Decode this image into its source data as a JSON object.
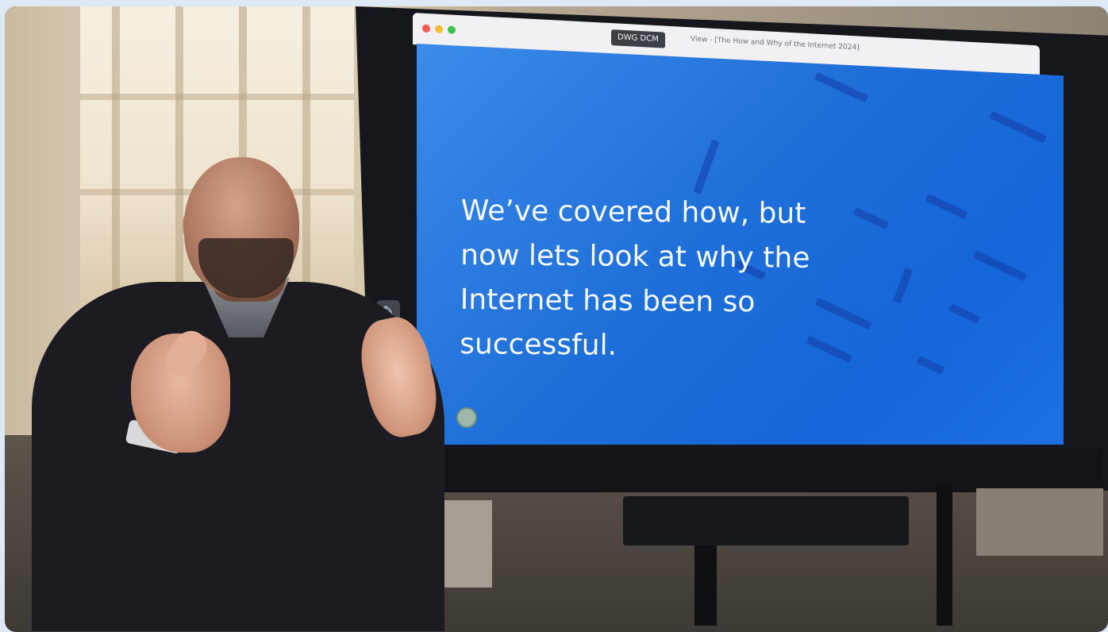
{
  "screen": {
    "app_window": {
      "badge": "DWG DCM",
      "title": "View - [The How and Why of the Internet 2024]"
    },
    "slide": {
      "text_lines": [
        "We’ve covered how, but",
        "now lets look at why the",
        "Internet has been so",
        "successful."
      ]
    }
  },
  "colors": {
    "slide_blue": "#1f6fd9",
    "slide_text": "#f4f8ff"
  }
}
